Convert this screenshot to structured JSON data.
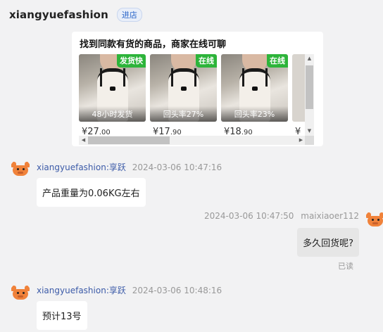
{
  "header": {
    "shop_name": "xiangyuefashion",
    "enter_label": "进店"
  },
  "recommend": {
    "title": "找到同款有货的商品，商家在线可聊",
    "products": [
      {
        "tag": "发货快",
        "caption": "48小时发货",
        "price_main": "¥27",
        "price_dec": ".00"
      },
      {
        "tag": "在线",
        "caption": "回头率27%",
        "price_main": "¥17",
        "price_dec": ".90"
      },
      {
        "tag": "在线",
        "caption": "回头率23%",
        "price_main": "¥18",
        "price_dec": ".90"
      },
      {
        "tag": "",
        "caption": "",
        "price_main": "¥",
        "price_dec": ""
      }
    ],
    "tag_color": "#2db43a"
  },
  "messages": [
    {
      "sender": "xiangyuefashion:享跃",
      "time": "2024-03-06 10:47:16",
      "text": "产品重量为0.06KG左右",
      "mine": false
    },
    {
      "sender": "maixiaoer112",
      "time": "2024-03-06 10:47:50",
      "text": "多久回货呢?",
      "mine": true,
      "status": "已读"
    },
    {
      "sender": "xiangyuefashion:享跃",
      "time": "2024-03-06 10:48:16",
      "text": "预计13号",
      "mine": false
    }
  ],
  "icons": {
    "avatar": "cow-avatar-icon",
    "scroll_up": "triangle-up-icon",
    "scroll_down": "triangle-down-icon",
    "scroll_left": "triangle-left-icon",
    "scroll_right": "triangle-right-icon"
  }
}
